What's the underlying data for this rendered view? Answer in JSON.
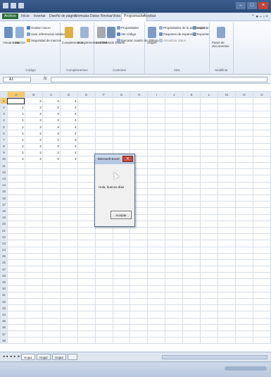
{
  "window": {
    "title": ""
  },
  "tabs": [
    {
      "label": "Archivo"
    },
    {
      "label": "Inicio"
    },
    {
      "label": "Insertar"
    },
    {
      "label": "Diseño de página"
    },
    {
      "label": "Fórmulas"
    },
    {
      "label": "Datos"
    },
    {
      "label": "Revisar"
    },
    {
      "label": "Vista"
    },
    {
      "label": "Programador"
    },
    {
      "label": "Acrobat"
    }
  ],
  "ribbon": {
    "groups": [
      {
        "name": "Código",
        "items": [
          "Visual Basic",
          "Macros",
          "Grabar macro",
          "Usar referencias relativas",
          "Seguridad de macros"
        ]
      },
      {
        "name": "Complementos",
        "items": [
          "Complementos",
          "Complementos COM"
        ]
      },
      {
        "name": "Controles",
        "items": [
          "Insertar",
          "Modo Diseño",
          "Propiedades",
          "Ver código",
          "Ejecutar cuadro de diálogo"
        ]
      },
      {
        "name": "XML",
        "items": [
          "Origen",
          "Propiedades de la asignación",
          "Paquetes de expansión",
          "Actualizar datos",
          "Importar",
          "Exportar"
        ]
      },
      {
        "name": "Modificar",
        "items": [
          "Panel de documentos"
        ]
      }
    ]
  },
  "formula_bar": {
    "name_box": "A1",
    "fx": "fx",
    "value": ""
  },
  "sheet": {
    "columns": [
      "A",
      "B",
      "C",
      "D",
      "E",
      "F",
      "G",
      "H",
      "I",
      "J",
      "K",
      "L",
      "M",
      "N",
      "O"
    ],
    "row_count": 38,
    "data_rows": [
      [
        "",
        "2",
        "3",
        "4"
      ],
      [
        "1",
        "2",
        "3",
        "4"
      ],
      [
        "1",
        "2",
        "3",
        "4"
      ],
      [
        "1",
        "2",
        "3",
        "4"
      ],
      [
        "1",
        "2",
        "3",
        "4"
      ],
      [
        "1",
        "2",
        "3",
        "4"
      ],
      [
        "1",
        "2",
        "3",
        "4"
      ],
      [
        "1",
        "2",
        "3",
        "4"
      ],
      [
        "1",
        "2",
        "3",
        "4"
      ],
      [
        "1",
        "2",
        "3",
        "4"
      ]
    ]
  },
  "sheet_tabs": [
    "Hoja1",
    "Hoja2",
    "Hoja3"
  ],
  "dialog": {
    "title": "Microsoft Excel",
    "message": "Hola, buenos días",
    "ok_label": "Aceptar",
    "close_glyph": "✕"
  },
  "colors": {
    "title_bar": "#2b4a78",
    "file_tab": "#2a6c3a",
    "selected_header": "#f4c96b",
    "close": "#c74a3e"
  }
}
